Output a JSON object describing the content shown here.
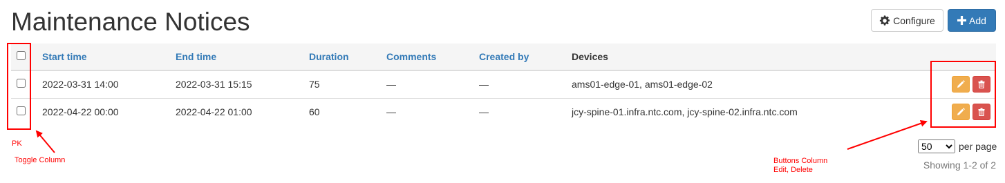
{
  "page": {
    "title": "Maintenance Notices"
  },
  "toolbar": {
    "configure_label": "Configure",
    "add_label": "Add"
  },
  "table": {
    "columns": [
      "Start time",
      "End time",
      "Duration",
      "Comments",
      "Created by",
      "Devices"
    ],
    "rows": [
      {
        "start_time": "2022-03-31 14:00",
        "end_time": "2022-03-31 15:15",
        "duration": "75",
        "comments": "—",
        "created_by": "—",
        "devices": "ams01-edge-01, ams01-edge-02"
      },
      {
        "start_time": "2022-04-22 00:00",
        "end_time": "2022-04-22 01:00",
        "duration": "60",
        "comments": "—",
        "created_by": "—",
        "devices": "jcy-spine-01.infra.ntc.com, jcy-spine-02.infra.ntc.com"
      }
    ]
  },
  "pagination": {
    "per_page_value": "50",
    "per_page_label": "per page",
    "showing": "Showing 1-2 of 2"
  },
  "annotations": {
    "pk": "PK",
    "toggle_column": "Toggle Column",
    "buttons_column_line1": "Buttons Column",
    "buttons_column_line2": "Edit, Delete"
  },
  "icons": {
    "configure": "gear-icon",
    "add": "plus-icon",
    "edit": "pencil-icon",
    "delete": "trash-icon"
  },
  "colors": {
    "primary": "#337ab7",
    "warning": "#f0ad4e",
    "danger": "#d9534f",
    "annotation": "#ff0000"
  }
}
